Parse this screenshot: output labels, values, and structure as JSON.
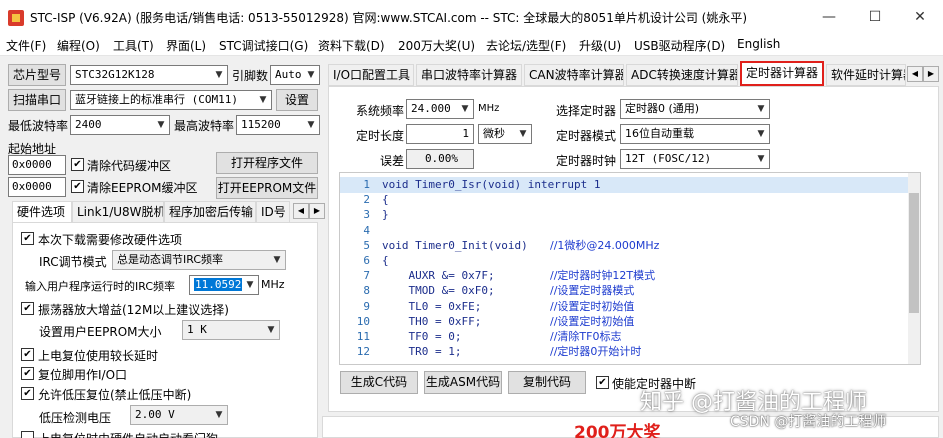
{
  "window": {
    "title": "STC-ISP (V6.92A) (服务电话/销售电话: 0513-55012928) 官网:www.STCAI.com  -- STC: 全球最大的8051单片机设计公司 (姚永平)",
    "min": "—",
    "max": "☐",
    "close": "✕"
  },
  "menu": [
    "文件(F)",
    "编程(O)",
    "工具(T)",
    "界面(L)",
    "STC调试接口(G)",
    "资料下载(D)",
    "200万大奖(U)",
    "去论坛/选型(F)",
    "升级(U)",
    "USB驱动程序(D)",
    "English"
  ],
  "left": {
    "chip_btn": "芯片型号",
    "chip_value": "STC32G12K128",
    "pin_label": "引脚数",
    "pin_value": "Auto",
    "scan_btn": "扫描串口",
    "port_value": "蓝牙链接上的标准串行 (COM11)",
    "settings_btn": "设置",
    "min_baud_label": "最低波特率",
    "min_baud_value": "2400",
    "max_baud_label": "最高波特率",
    "max_baud_value": "115200",
    "start_addr_label": "起始地址",
    "addr1": "0x0000",
    "clear_code_label": "清除代码缓冲区",
    "open_prog_btn": "打开程序文件",
    "addr2": "0x0000",
    "clear_eeprom_label": "清除EEPROM缓冲区",
    "open_eeprom_btn": "打开EEPROM文件",
    "tabs": [
      "硬件选项",
      "Link1/U8W脱机",
      "程序加密后传输",
      "ID号"
    ],
    "options": {
      "opt1": "本次下载需要修改硬件选项",
      "irc_mode_label": "IRC调节模式",
      "irc_mode_value": "总是动态调节IRC频率",
      "irc_freq_label": "输入用户程序运行时的IRC频率",
      "irc_freq_value": "11.0592",
      "irc_freq_unit": "MHz",
      "opt2": "振荡器放大增益(12M以上建议选择)",
      "eeprom_size_label": "设置用户EEPROM大小",
      "eeprom_size_value": "1   K",
      "opt3": "上电复位使用较长延时",
      "opt4": "复位脚用作I/O口",
      "opt5": "允许低压复位(禁止低压中断)",
      "lvd_label": "低压检测电压",
      "lvd_value": "2.00 V",
      "opt6": "上电复位时由硬件自动启动看门狗"
    }
  },
  "right": {
    "tabs": [
      "I/O口配置工具",
      "串口波特率计算器",
      "CAN波特率计算器",
      "ADC转换速度计算器",
      "定时器计算器",
      "软件延时计算器"
    ],
    "sys_freq_label": "系统频率",
    "sys_freq_value": "24.000",
    "sys_freq_unit": "MHz",
    "timer_sel_label": "选择定时器",
    "timer_sel_value": "定时器0 (通用)",
    "duration_label": "定时长度",
    "duration_value": "1",
    "duration_unit": "微秒",
    "timer_mode_label": "定时器模式",
    "timer_mode_value": "16位自动重载",
    "error_label": "误差",
    "error_value": "0.00%",
    "timer_clock_label": "定时器时钟",
    "timer_clock_value": "12T (FOSC/12)",
    "gen_c_btn": "生成C代码",
    "gen_asm_btn": "生成ASM代码",
    "copy_btn": "复制代码",
    "enable_int_label": "使能定时器中断",
    "banner": "200万大奖"
  },
  "code": [
    {
      "n": "1",
      "t": "void Timer0_Isr(void) interrupt 1",
      "c": ""
    },
    {
      "n": "2",
      "t": "{",
      "c": ""
    },
    {
      "n": "3",
      "t": "}",
      "c": ""
    },
    {
      "n": "4",
      "t": "",
      "c": ""
    },
    {
      "n": "5",
      "t": "void Timer0_Init(void)",
      "c": "//1微秒@24.000MHz"
    },
    {
      "n": "6",
      "t": "{",
      "c": ""
    },
    {
      "n": "7",
      "t": "    AUXR &= 0x7F;",
      "c": "//定时器时钟12T模式"
    },
    {
      "n": "8",
      "t": "    TMOD &= 0xF0;",
      "c": "//设置定时器模式"
    },
    {
      "n": "9",
      "t": "    TL0 = 0xFE;",
      "c": "//设置定时初始值"
    },
    {
      "n": "10",
      "t": "    TH0 = 0xFF;",
      "c": "//设置定时初始值"
    },
    {
      "n": "11",
      "t": "    TF0 = 0;",
      "c": "//清除TF0标志"
    },
    {
      "n": "12",
      "t": "    TR0 = 1;",
      "c": "//定时器0开始计时"
    }
  ],
  "watermark": {
    "line1": "知乎 @打酱油的工程师",
    "line2": "CSDN @打酱油的工程师"
  },
  "colors": {
    "highlight_border": "#e0201b",
    "selected_text_bg": "#0078d7",
    "code_highlight": "#d8e8f8"
  }
}
